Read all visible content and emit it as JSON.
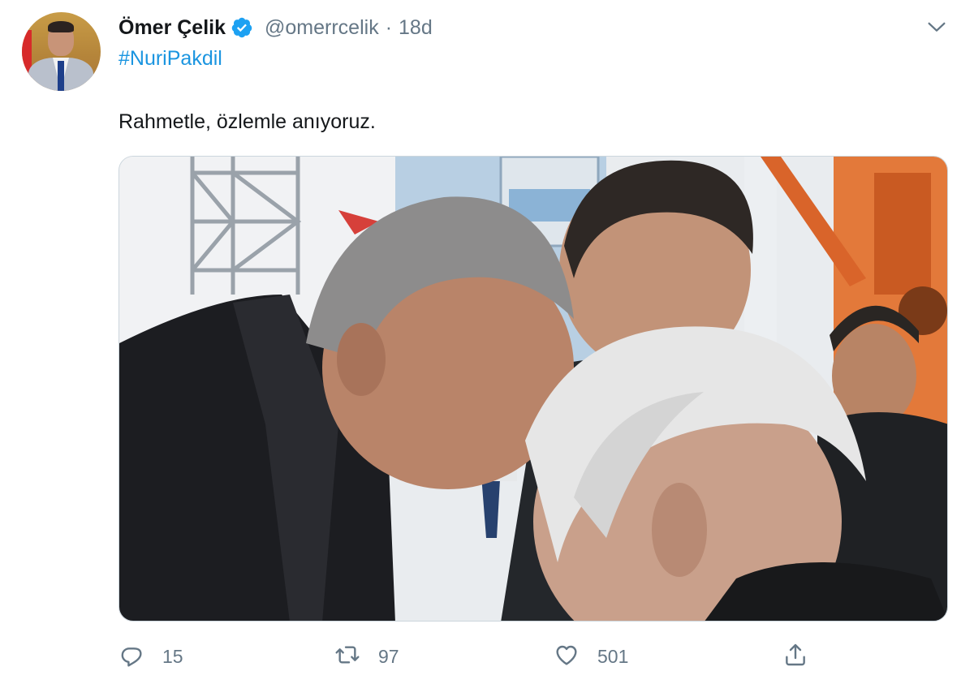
{
  "tweet": {
    "author_name": "Ömer Çelik",
    "handle": "@omerrcelik",
    "separator": "·",
    "time": "18d",
    "hashtag": "#NuriPakdil",
    "text": "Rahmetle, özlemle anıyoruz.",
    "verified_icon": "verified-badge-icon",
    "caret_icon": "chevron-down-icon"
  },
  "actions": {
    "reply": {
      "icon": "reply-icon",
      "count": "15"
    },
    "retweet": {
      "icon": "retweet-icon",
      "count": "97"
    },
    "like": {
      "icon": "heart-icon",
      "count": "501"
    },
    "share": {
      "icon": "share-icon"
    }
  },
  "colors": {
    "text": "#14171a",
    "secondary": "#657786",
    "link": "#1b95e0",
    "verified": "#1da1f2",
    "background": "#ffffff"
  }
}
